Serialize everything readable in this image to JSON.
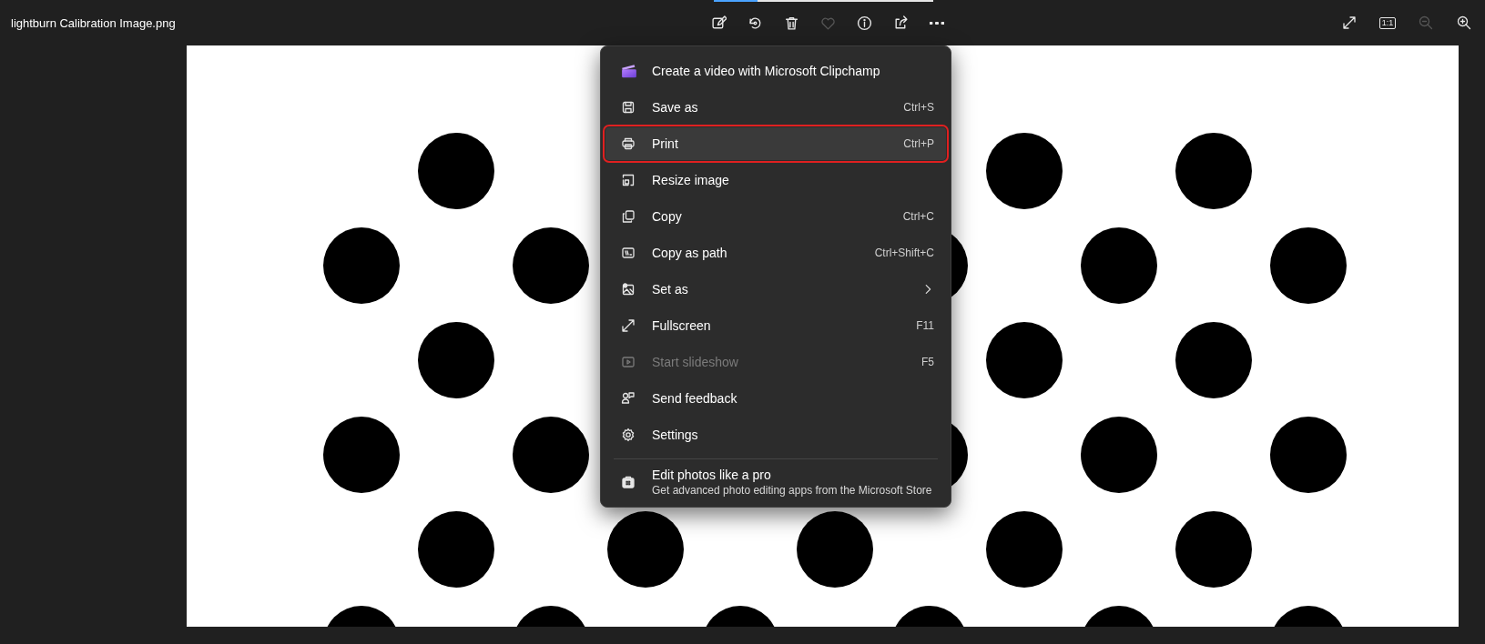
{
  "window": {
    "title": "lightburn Calibration Image.png"
  },
  "toolbar": {
    "buttons": [
      {
        "disabled": false
      },
      {
        "disabled": false
      },
      {
        "disabled": false
      },
      {
        "disabled": true
      },
      {
        "disabled": false
      },
      {
        "disabled": false
      },
      {
        "disabled": false
      }
    ]
  },
  "view_controls": [
    {
      "disabled": false
    },
    {
      "label": "1:1",
      "disabled": false
    },
    {
      "disabled": true
    },
    {
      "disabled": false
    }
  ],
  "menu": {
    "items": [
      {
        "kind": "action",
        "label": "Create a video with Microsoft Clipchamp",
        "disabled": false,
        "highlighted": false
      },
      {
        "kind": "action",
        "label": "Save as",
        "shortcut": "Ctrl+S",
        "disabled": false,
        "highlighted": false
      },
      {
        "kind": "action",
        "label": "Print",
        "shortcut": "Ctrl+P",
        "disabled": false,
        "highlighted": true
      },
      {
        "kind": "action",
        "label": "Resize image",
        "disabled": false,
        "highlighted": false
      },
      {
        "kind": "action",
        "label": "Copy",
        "shortcut": "Ctrl+C",
        "disabled": false,
        "highlighted": false
      },
      {
        "kind": "action",
        "label": "Copy as path",
        "shortcut": "Ctrl+Shift+C",
        "disabled": false,
        "highlighted": false
      },
      {
        "kind": "submenu",
        "label": "Set as",
        "disabled": false,
        "highlighted": false
      },
      {
        "kind": "action",
        "label": "Fullscreen",
        "shortcut": "F11",
        "disabled": false,
        "highlighted": false
      },
      {
        "kind": "action",
        "label": "Start slideshow",
        "shortcut": "F5",
        "disabled": true,
        "highlighted": false
      },
      {
        "kind": "action",
        "label": "Send feedback",
        "disabled": false,
        "highlighted": false
      },
      {
        "kind": "action",
        "label": "Settings",
        "disabled": false,
        "highlighted": false
      },
      {
        "kind": "promo",
        "label": "Edit photos like a pro",
        "subtitle": "Get advanced photo editing apps from the Microsoft Store",
        "disabled": false,
        "highlighted": false
      }
    ]
  }
}
